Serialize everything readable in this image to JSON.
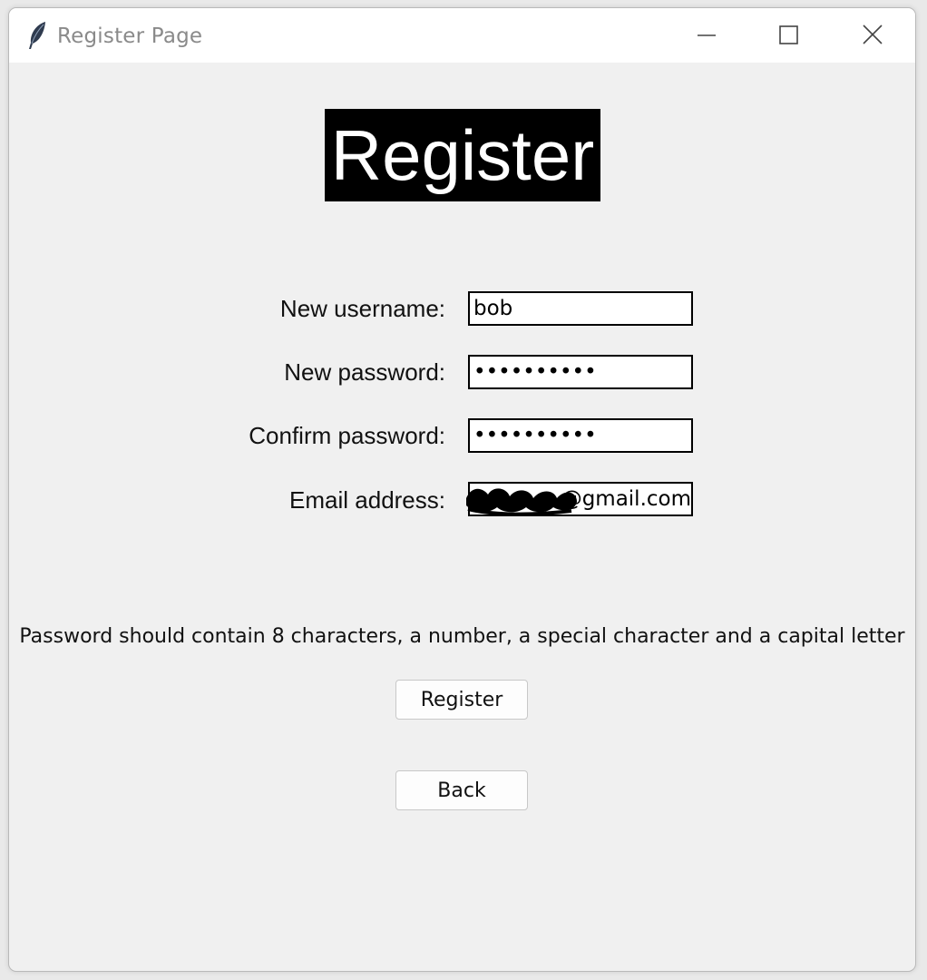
{
  "window": {
    "title": "Register Page",
    "icon": "feather-icon",
    "controls": [
      "minimize-icon",
      "maximize-icon",
      "close-icon"
    ]
  },
  "form": {
    "heading": "Register",
    "username_label": "New username:",
    "username_value": "bob",
    "password_label": "New password:",
    "password_value": "••••••••••",
    "confirm_label": "Confirm password:",
    "confirm_value": "••••••••••",
    "email_label": "Email address:",
    "email_value": "@gmail.com",
    "hint": "Password should contain 8 characters, a number, a special character and a capital letter",
    "register_button": "Register",
    "back_button": "Back"
  },
  "colors": {
    "background": "#f0f0f0",
    "heading_bg": "#000000",
    "heading_fg": "#ffffff"
  }
}
